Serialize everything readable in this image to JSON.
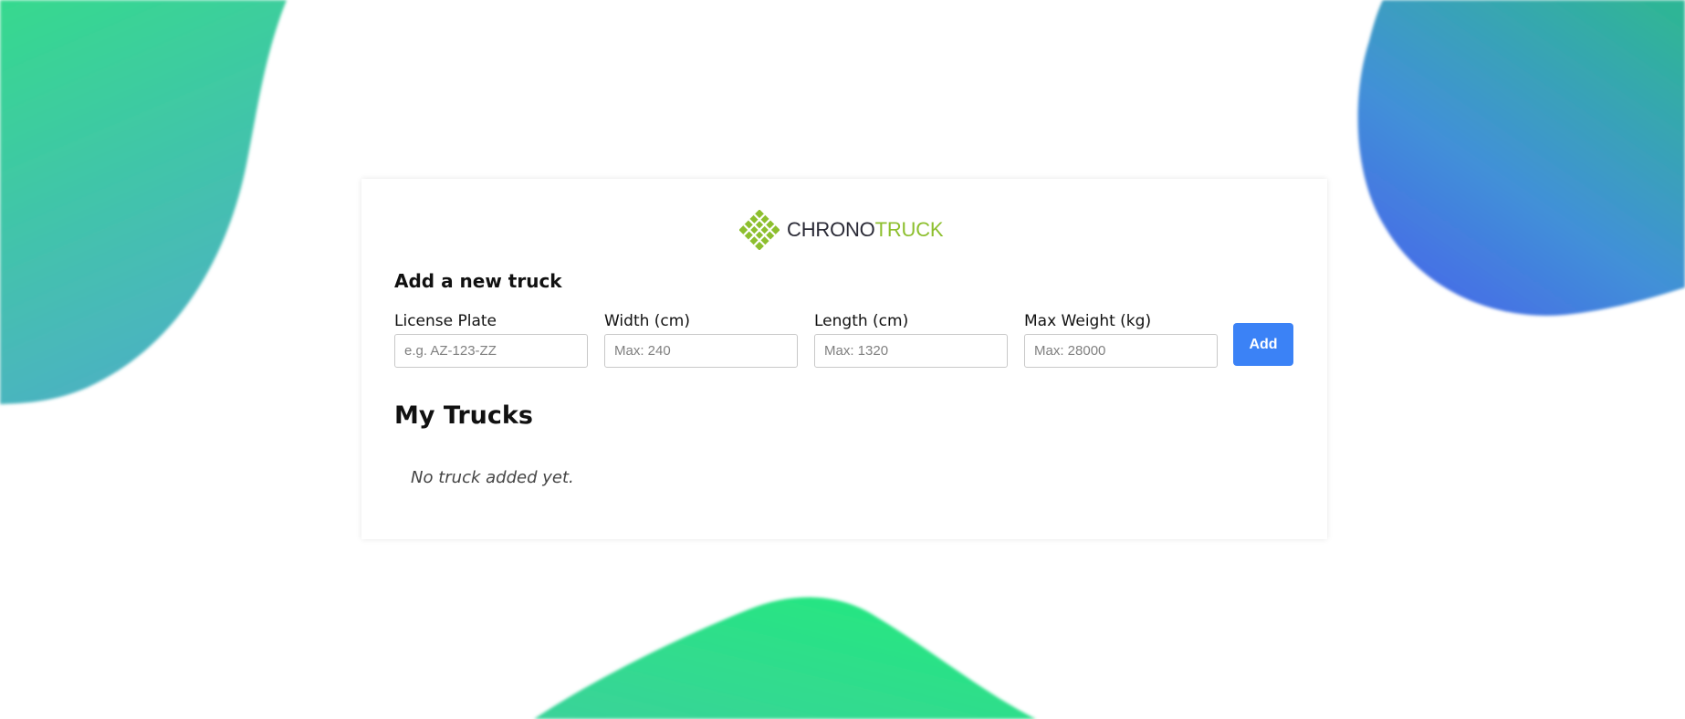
{
  "brand": {
    "part1": "CHRONO",
    "part2": "TRUCK",
    "color_dark": "#2a2a36",
    "color_green": "#8dbf2e",
    "icon": "diagonal-grid-logo-icon"
  },
  "form": {
    "title": "Add a new truck",
    "fields": [
      {
        "label": "License Plate",
        "placeholder": "e.g. AZ-123-ZZ",
        "value": ""
      },
      {
        "label": "Width (cm)",
        "placeholder": "Max: 240",
        "value": ""
      },
      {
        "label": "Length (cm)",
        "placeholder": "Max: 1320",
        "value": ""
      },
      {
        "label": "Max Weight (kg)",
        "placeholder": "Max: 28000",
        "value": ""
      }
    ],
    "submit_label": "Add",
    "accent_color": "#3b82f6"
  },
  "trucks": {
    "title": "My Trucks",
    "empty_text": "No truck added yet.",
    "items": []
  },
  "background": {
    "blob_colors": [
      "#2ee88a",
      "#4aaac0",
      "#4a6de8"
    ]
  }
}
